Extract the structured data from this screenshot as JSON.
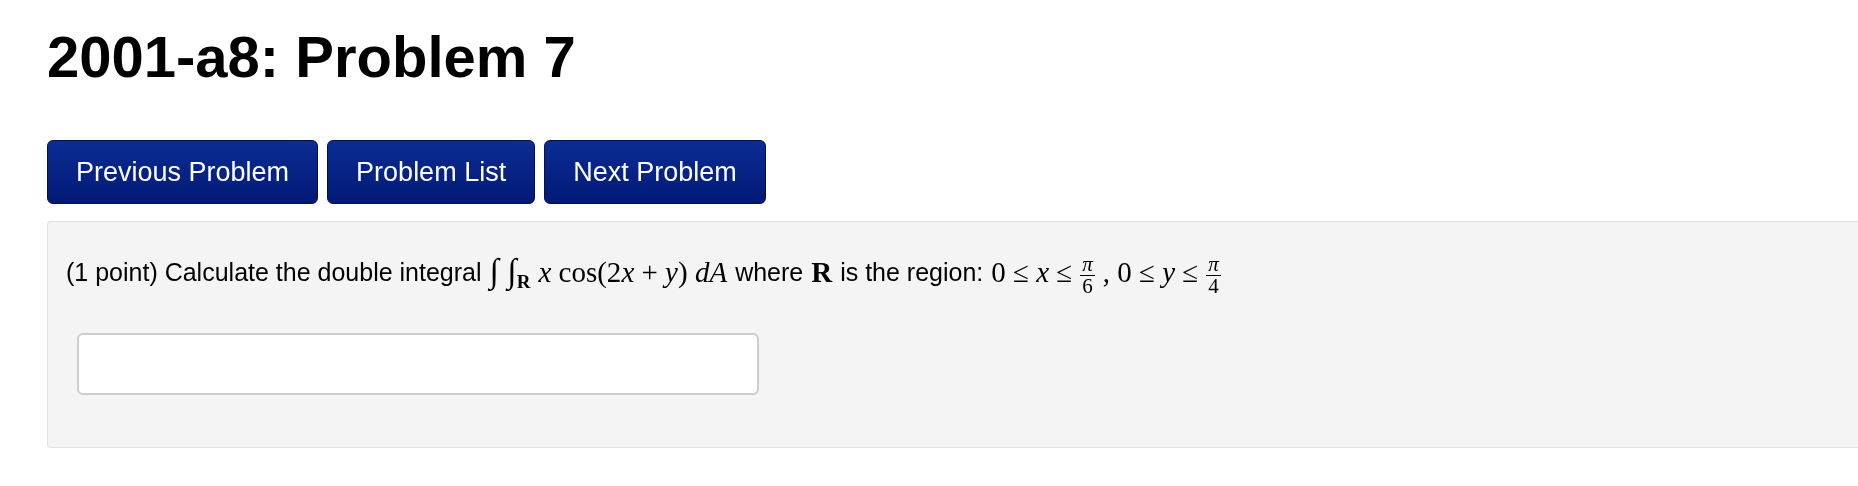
{
  "title": "2001-a8: Problem 7",
  "nav_buttons": [
    "Previous Problem",
    "Problem List",
    "Next Problem"
  ],
  "problem": {
    "statement": [
      {
        "kind": "text",
        "text": "(1 point) Calculate the double integral"
      },
      {
        "kind": "math",
        "tokens": [
          {
            "text": "∫ ∫",
            "kind": "integral"
          },
          {
            "text": "R",
            "kind": "subscript"
          },
          {
            "text": "x",
            "kind": "variable"
          },
          {
            "text": " cos(2",
            "kind": "operator"
          },
          {
            "text": "x",
            "kind": "variable"
          },
          {
            "text": " + ",
            "kind": "operator"
          },
          {
            "text": "y",
            "kind": "variable"
          },
          {
            "text": ") ",
            "kind": "operator"
          },
          {
            "text": "dA",
            "kind": "variable"
          }
        ]
      },
      {
        "kind": "text",
        "text": "where"
      },
      {
        "kind": "math",
        "tokens": [
          {
            "text": "R",
            "kind": "bold"
          }
        ]
      },
      {
        "kind": "text",
        "text": "is the region:"
      },
      {
        "kind": "math",
        "tokens": [
          {
            "text": "0 ≤ ",
            "kind": "operator"
          },
          {
            "text": "x",
            "kind": "variable"
          },
          {
            "text": " ≤",
            "kind": "operator"
          }
        ]
      },
      {
        "kind": "fraction",
        "numerator": "π",
        "denominator": "6"
      },
      {
        "kind": "math",
        "tokens": [
          {
            "text": ", 0 ≤ ",
            "kind": "operator"
          },
          {
            "text": "y",
            "kind": "variable"
          },
          {
            "text": " ≤",
            "kind": "operator"
          }
        ]
      },
      {
        "kind": "fraction",
        "numerator": "π",
        "denominator": "4"
      }
    ]
  }
}
